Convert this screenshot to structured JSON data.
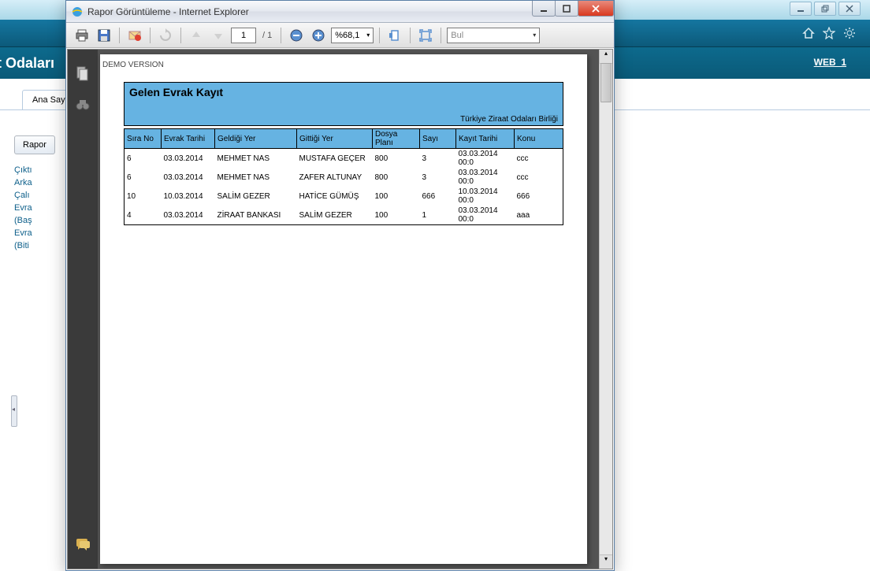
{
  "bg": {
    "header_title": "t Odaları",
    "web_id": "WEB_1",
    "tab_label": "Ana Say",
    "rapor_btn": "Rapor",
    "labels": [
      "Çıktı",
      "Arka",
      "Çalı",
      "Evra",
      "(Baş",
      "Evra",
      "(Biti"
    ]
  },
  "ie": {
    "title": "Rapor Görüntüleme - Internet Explorer"
  },
  "toolbar": {
    "page_current": "1",
    "page_total": "/ 1",
    "zoom_value": "%68,1",
    "search_placeholder": "Bul"
  },
  "page": {
    "demo": "DEMO VERSION",
    "title": "Gelen Evrak Kayıt",
    "org": "Türkiye Ziraat Odaları Birliği"
  },
  "table": {
    "headers": [
      "Sıra No",
      "Evrak Tarihi",
      "Geldiği Yer",
      "Gittiği Yer",
      "Dosya Planı",
      "Sayı",
      "Kayıt Tarihi",
      "Konu"
    ],
    "rows": [
      [
        "6",
        "03.03.2014",
        "MEHMET NAS",
        "MUSTAFA GEÇER",
        "800",
        "3",
        "03.03.2014 00:0",
        "ccc"
      ],
      [
        "6",
        "03.03.2014",
        "MEHMET NAS",
        "ZAFER ALTUNAY",
        "800",
        "3",
        "03.03.2014 00:0",
        "ccc"
      ],
      [
        "10",
        "10.03.2014",
        "SALİM GEZER",
        "HATİCE GÜMÜŞ",
        "100",
        "666",
        "10.03.2014 00:0",
        "666"
      ],
      [
        "4",
        "03.03.2014",
        "ZİRAAT BANKASI",
        "SALİM GEZER",
        "100",
        "1",
        "03.03.2014 00:0",
        "aaa"
      ]
    ]
  }
}
